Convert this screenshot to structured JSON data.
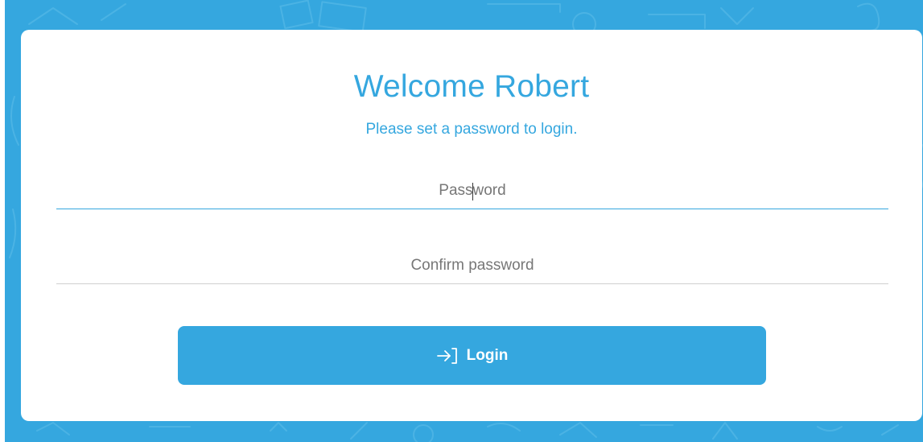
{
  "theme": {
    "accent": "#35a7df",
    "card_bg": "#ffffff",
    "field_line": "#cfcfcf",
    "placeholder": "#777777"
  },
  "welcome": {
    "title": "Welcome Robert",
    "subtitle": "Please set a password to login."
  },
  "form": {
    "password": {
      "placeholder": "Password",
      "value": "",
      "focused": true
    },
    "confirm_password": {
      "placeholder": "Confirm password",
      "value": ""
    },
    "login_button": {
      "label": "Login",
      "icon": "login-arrow-icon"
    }
  }
}
